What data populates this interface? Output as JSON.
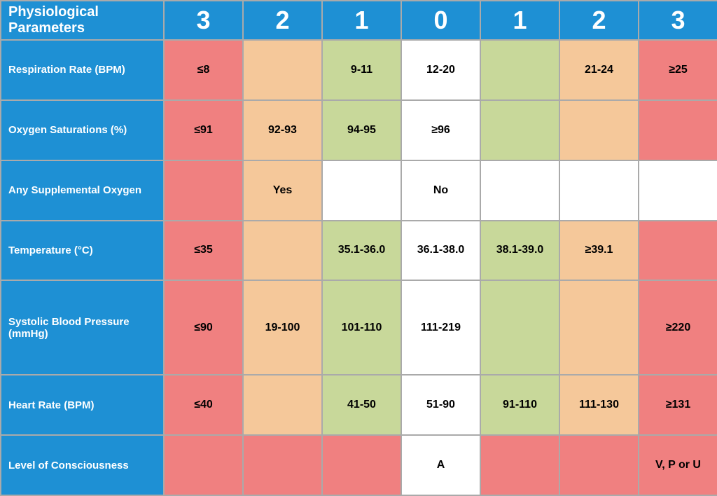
{
  "header": {
    "param_label": "Physiological Parameters",
    "scores": [
      "3",
      "2",
      "1",
      "0",
      "1",
      "2",
      "3"
    ]
  },
  "rows": [
    {
      "label": "Respiration Rate (BPM)",
      "cells": [
        {
          "value": "≤8",
          "color": "red"
        },
        {
          "value": "",
          "color": "orange"
        },
        {
          "value": "9-11",
          "color": "yellow-green"
        },
        {
          "value": "12-20",
          "color": "white"
        },
        {
          "value": "",
          "color": "yellow-green"
        },
        {
          "value": "21-24",
          "color": "orange"
        },
        {
          "value": "≥25",
          "color": "red"
        }
      ]
    },
    {
      "label": "Oxygen Saturations (%)",
      "cells": [
        {
          "value": "≤91",
          "color": "red"
        },
        {
          "value": "92-93",
          "color": "orange"
        },
        {
          "value": "94-95",
          "color": "yellow-green"
        },
        {
          "value": "≥96",
          "color": "white"
        },
        {
          "value": "",
          "color": "yellow-green"
        },
        {
          "value": "",
          "color": "orange"
        },
        {
          "value": "",
          "color": "red"
        }
      ]
    },
    {
      "label": "Any Supplemental Oxygen",
      "cells": [
        {
          "value": "",
          "color": "red"
        },
        {
          "value": "Yes",
          "color": "orange"
        },
        {
          "value": "",
          "color": "white"
        },
        {
          "value": "No",
          "color": "white"
        },
        {
          "value": "",
          "color": "white"
        },
        {
          "value": "",
          "color": "white"
        },
        {
          "value": "",
          "color": "white"
        }
      ]
    },
    {
      "label": "Temperature (°C)",
      "cells": [
        {
          "value": "≤35",
          "color": "red"
        },
        {
          "value": "",
          "color": "orange"
        },
        {
          "value": "35.1-36.0",
          "color": "yellow-green"
        },
        {
          "value": "36.1-38.0",
          "color": "white"
        },
        {
          "value": "38.1-39.0",
          "color": "yellow-green"
        },
        {
          "value": "≥39.1",
          "color": "orange"
        },
        {
          "value": "",
          "color": "red"
        }
      ]
    },
    {
      "label": "Systolic Blood Pressure (mmHg)",
      "cells": [
        {
          "value": "≤90",
          "color": "red"
        },
        {
          "value": "19-100",
          "color": "orange"
        },
        {
          "value": "101-110",
          "color": "yellow-green"
        },
        {
          "value": "111-219",
          "color": "white"
        },
        {
          "value": "",
          "color": "yellow-green"
        },
        {
          "value": "",
          "color": "orange"
        },
        {
          "value": "≥220",
          "color": "red"
        }
      ]
    },
    {
      "label": "Heart Rate (BPM)",
      "cells": [
        {
          "value": "≤40",
          "color": "red"
        },
        {
          "value": "",
          "color": "orange"
        },
        {
          "value": "41-50",
          "color": "yellow-green"
        },
        {
          "value": "51-90",
          "color": "white"
        },
        {
          "value": "91-110",
          "color": "yellow-green"
        },
        {
          "value": "111-130",
          "color": "orange"
        },
        {
          "value": "≥131",
          "color": "red"
        }
      ]
    },
    {
      "label": "Level of Consciousness",
      "cells": [
        {
          "value": "",
          "color": "red"
        },
        {
          "value": "",
          "color": "red"
        },
        {
          "value": "",
          "color": "red"
        },
        {
          "value": "A",
          "color": "white"
        },
        {
          "value": "",
          "color": "red"
        },
        {
          "value": "",
          "color": "red"
        },
        {
          "value": "V, P or U",
          "color": "red"
        }
      ]
    }
  ]
}
